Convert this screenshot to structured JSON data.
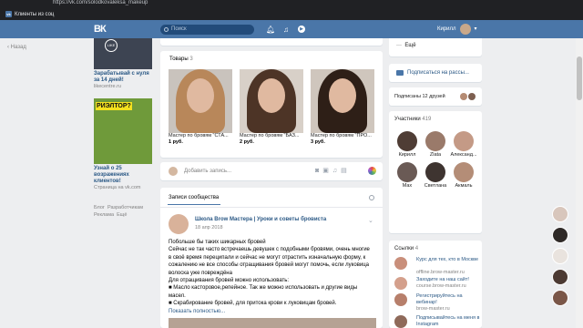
{
  "browser": {
    "url": "https://vk.com/solodkovaleksa_makeup",
    "bookmark": "Клиенты из соц"
  },
  "header": {
    "logo": "ВК",
    "search_placeholder": "Поиск",
    "user_name": "Кирилл",
    "icons": [
      "bell-icon",
      "music-icon",
      "play-icon"
    ]
  },
  "left": {
    "back_label": "Назад"
  },
  "ads": [
    {
      "title": "Зарабатывай с нуля за 14 дней!",
      "source": "likecentre.ru",
      "image_text": "LIKE"
    },
    {
      "title": "Узнай о 25 возражениях клиентов!",
      "source": "Страница на vk.com",
      "image_text": "РИЭЛТОР?"
    }
  ],
  "left_links": [
    "Блог",
    "Разработчикам",
    "Реклама",
    "Ещё"
  ],
  "goods": {
    "title": "Товары",
    "count": "3",
    "items": [
      {
        "name": "Мастер по бровям \"СТА...",
        "price": "1 руб."
      },
      {
        "name": "Мастер по бровям \"БАЗ...",
        "price": "2 руб."
      },
      {
        "name": "Мастер по бровям \"ПРО...",
        "price": "3 руб."
      }
    ]
  },
  "composer": {
    "placeholder": "Добавить запись...",
    "icons": [
      "camera-icon",
      "image-icon",
      "music-icon",
      "document-icon"
    ]
  },
  "wall": {
    "tab": "Записи сообщества",
    "post": {
      "author": "Школа Brow Мастера | Уроки и советы бровиста",
      "date": "18 апр 2018",
      "lines": [
        "Побольше бы таких шикарных бровей",
        "Сейчас не так часто встречаешь девушек с подобными бровями, очень многие",
        "в своё время переципали и сейчас не могут отрастить изначальную форму, к",
        "сожалению не все способы отращивания бровей могут помочь, если луковица",
        "волоска уже повреждёна",
        "Для отращивания бровей можно использовать:",
        "■ Масло касторовое,репейное. Так же можно использовать и другие виды",
        "масел.",
        "■ Скрабирование бровей, для притока крови к луковицам бровей."
      ],
      "more": "Показать полностью..."
    }
  },
  "right": {
    "more": "Ещё",
    "subscribe": "Подписаться на рассы...",
    "friends": "Подписаны 12 друзей",
    "members_title": "Участники",
    "members_count": "419",
    "members": [
      "Кирилл",
      "Zlata",
      "Александ...",
      "Max",
      "Светлана",
      "Акмаль"
    ],
    "links_title": "Ссылки",
    "links_count": "4",
    "links": [
      {
        "title": "Курс для тех, кто в Москве",
        "sub": "offline.brow-master.ru"
      },
      {
        "title": "Заходите на наш сайт!",
        "sub": "course.brow-master.ru"
      },
      {
        "title": "Регистрируйтесь на вебинар!",
        "sub": "brow-master.ru"
      },
      {
        "title": "Подписывайтесь на меня в Instagram",
        "sub": "www.instagram.com"
      }
    ]
  }
}
